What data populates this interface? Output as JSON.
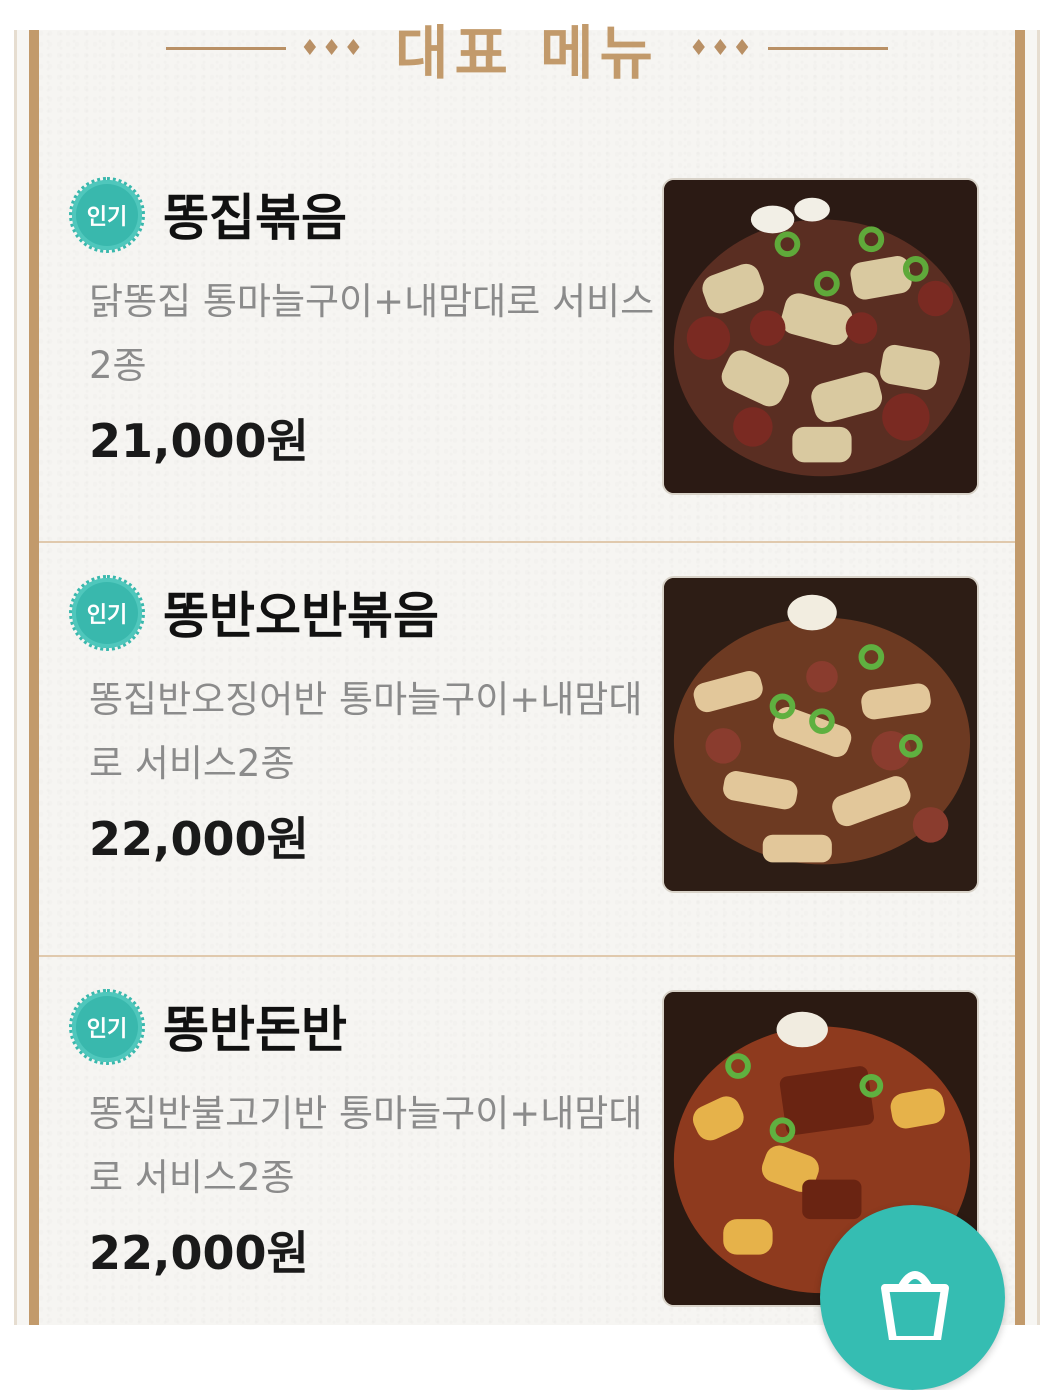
{
  "section": {
    "title": "대표 메뉴",
    "ornament": "♦♦♦"
  },
  "menu": [
    {
      "badge": "인기",
      "name": "똥집볶음",
      "description": "닭똥집 통마늘구이+내맘대로 서비스2종",
      "price": "21,000원"
    },
    {
      "badge": "인기",
      "name": "똥반오반볶음",
      "description": "똥집반오징어반 통마늘구이+내맘대로 서비스2종",
      "price": "22,000원"
    },
    {
      "badge": "인기",
      "name": "똥반돈반",
      "description": "똥집반불고기반 통마늘구이+내맘대로 서비스2종",
      "price": "22,000원"
    }
  ],
  "colors": {
    "accent_teal": "#39b8ad",
    "frame_gold": "#c29a6b",
    "price_text": "#1a1a1a"
  },
  "icons": {
    "cart": "shopping-bag-icon"
  }
}
